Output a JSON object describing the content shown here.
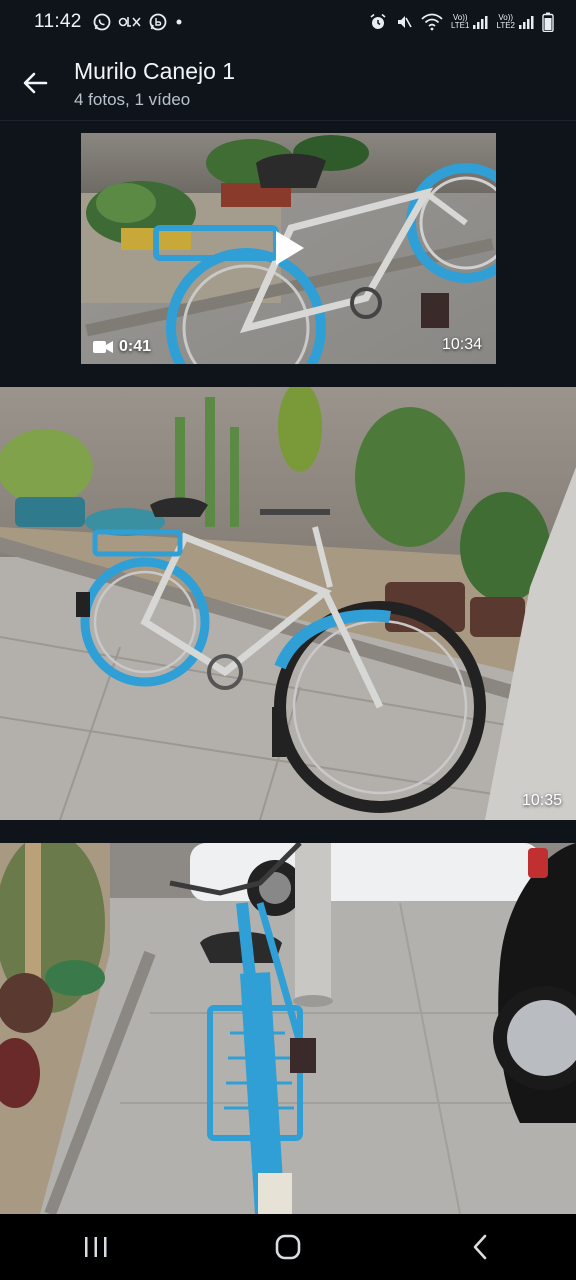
{
  "status_bar": {
    "time": "11:42",
    "left_icons": [
      "whatsapp-icon",
      "olx-icon",
      "whatsapp-business-icon",
      "dot-icon"
    ],
    "right_icons": [
      "alarm-icon",
      "mute-icon",
      "wifi-icon",
      "signal-sim1-icon",
      "signal-sim2-icon",
      "battery-icon"
    ],
    "sim1_label_top": "Vo))",
    "sim1_label_bottom": "LTE1",
    "sim2_label_top": "Vo))",
    "sim2_label_bottom": "LTE2"
  },
  "header": {
    "title": "Murilo Canejo 1",
    "subtitle": "4 fotos, 1 vídeo",
    "back_icon": "arrow-left-icon"
  },
  "media": [
    {
      "type": "video",
      "duration": "0:41",
      "time": "10:34"
    },
    {
      "type": "photo",
      "time": "10:35"
    },
    {
      "type": "photo",
      "time": ""
    }
  ],
  "nav_bar": {
    "icons": [
      "recents-icon",
      "home-icon",
      "back-icon"
    ]
  },
  "colors": {
    "background": "#0f141a",
    "bike_blue": "#2f9fd6",
    "nav_bar": "#000000"
  }
}
